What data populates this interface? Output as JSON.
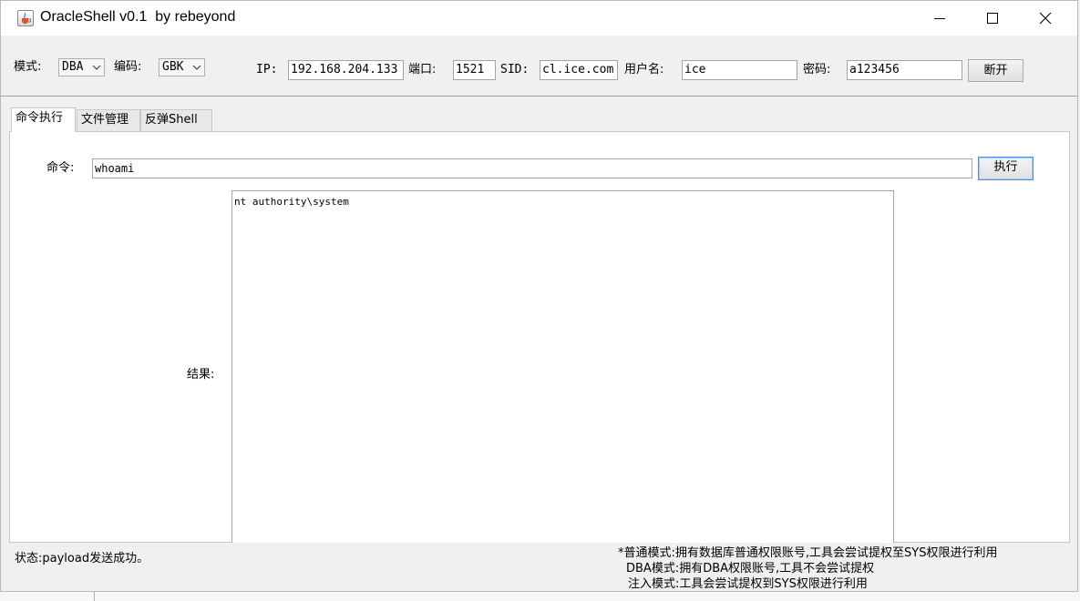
{
  "window": {
    "title": "OracleShell v0.1  by rebeyond"
  },
  "connection": {
    "mode_label": "模式:",
    "mode_value": "DBA",
    "encoding_label": "编码:",
    "encoding_value": "GBK",
    "ip_label": "IP:",
    "ip_value": "192.168.204.133",
    "port_label": "端口:",
    "port_value": "1521",
    "sid_label": "SID:",
    "sid_value": "cl.ice.com",
    "user_label": "用户名:",
    "user_value": "ice",
    "password_label": "密码:",
    "password_value": "a123456",
    "disconnect_label": "断开"
  },
  "tabs": [
    {
      "label": "命令执行",
      "active": true
    },
    {
      "label": "文件管理",
      "active": false
    },
    {
      "label": "反弹Shell",
      "active": false
    }
  ],
  "command": {
    "label": "命令:",
    "value": "whoami",
    "execute_label": "执行",
    "result_label": "结果:",
    "result_text": "nt authority\\system"
  },
  "status": {
    "text": "状态:payload发送成功。",
    "notes": [
      "*普通模式:拥有数据库普通权限账号,工具会尝试提权至SYS权限进行利用",
      "DBA模式:拥有DBA权限账号,工具不会尝试提权",
      "注入模式:工具会尝试提权到SYS权限进行利用"
    ]
  },
  "icons": {
    "app": "java-cup-icon",
    "minimize": "minimize-icon",
    "maximize": "maximize-icon",
    "close": "close-icon",
    "dropdown": "chevron-down-icon"
  }
}
